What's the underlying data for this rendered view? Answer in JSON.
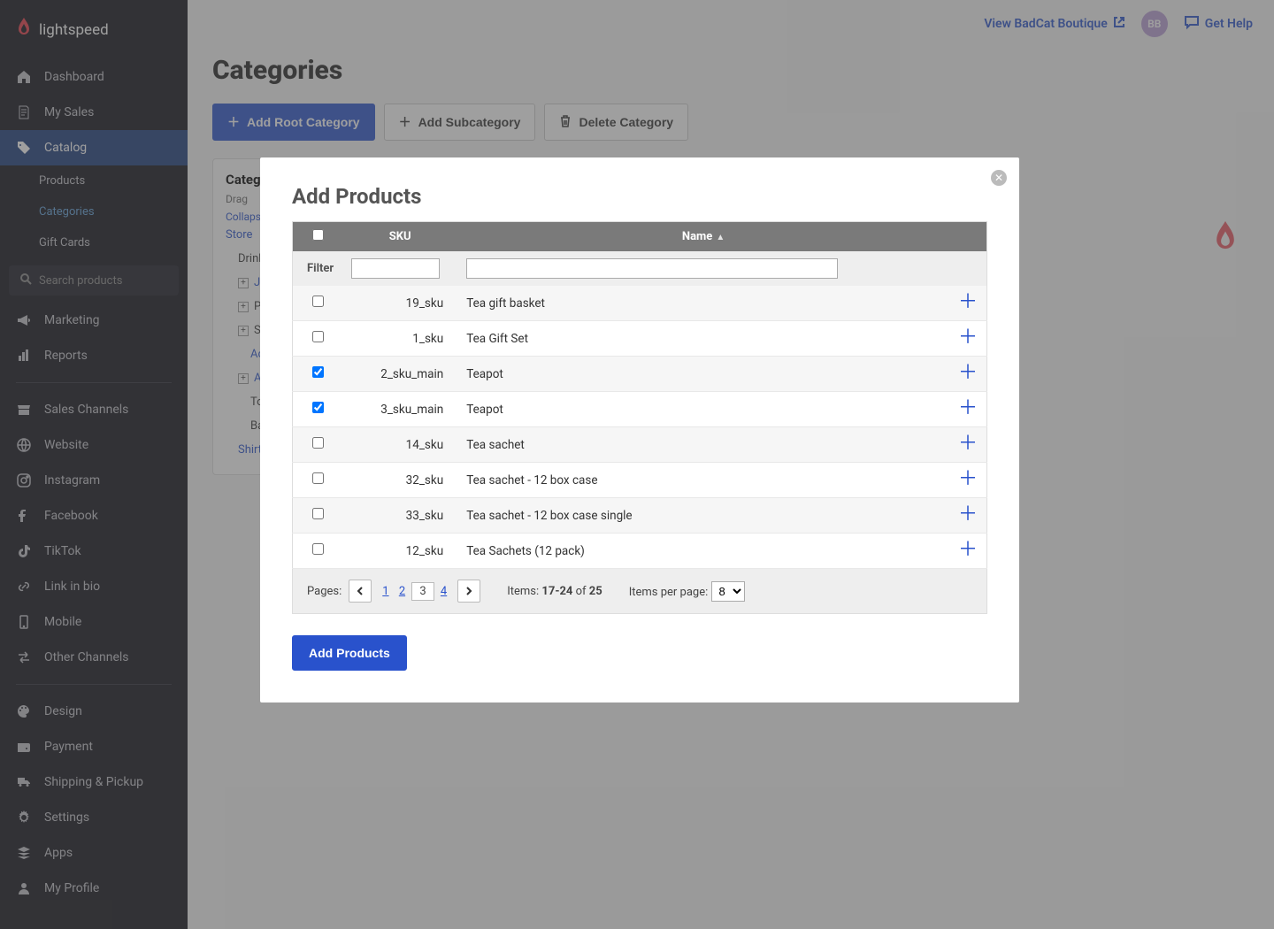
{
  "brand": "lightspeed",
  "header": {
    "view_store": "View BadCat Boutique",
    "avatar": "BB",
    "help": "Get Help"
  },
  "sidebar": {
    "items": [
      {
        "label": "Dashboard",
        "icon": "home"
      },
      {
        "label": "My Sales",
        "icon": "note"
      },
      {
        "label": "Catalog",
        "icon": "tag",
        "active": true
      },
      {
        "label": "Marketing",
        "icon": "megaphone"
      },
      {
        "label": "Reports",
        "icon": "bars"
      },
      {
        "label": "Sales Channels",
        "icon": "store"
      },
      {
        "label": "Website",
        "icon": "globe"
      },
      {
        "label": "Instagram",
        "icon": "instagram"
      },
      {
        "label": "Facebook",
        "icon": "facebook"
      },
      {
        "label": "TikTok",
        "icon": "tiktok"
      },
      {
        "label": "Link in bio",
        "icon": "link"
      },
      {
        "label": "Mobile",
        "icon": "mobile"
      },
      {
        "label": "Other Channels",
        "icon": "switch"
      },
      {
        "label": "Design",
        "icon": "palette"
      },
      {
        "label": "Payment",
        "icon": "wallet"
      },
      {
        "label": "Shipping & Pickup",
        "icon": "truck"
      },
      {
        "label": "Settings",
        "icon": "gear"
      },
      {
        "label": "Apps",
        "icon": "layers"
      },
      {
        "label": "My Profile",
        "icon": "user"
      }
    ],
    "catalog_sub": [
      {
        "label": "Products"
      },
      {
        "label": "Categories",
        "active": true
      },
      {
        "label": "Gift Cards"
      }
    ],
    "search_placeholder": "Search products"
  },
  "page": {
    "title": "Categories",
    "btn_add_root": "Add Root Category",
    "btn_add_sub": "Add Subcategory",
    "btn_delete": "Delete Category"
  },
  "cat_panel": {
    "title": "Categories",
    "help": "Drag",
    "collapse": "Collapse",
    "tree": [
      {
        "label": "Store",
        "link": true
      },
      {
        "label": "Drinkware",
        "link": false,
        "indent": 1
      },
      {
        "label": "Jackets",
        "link": true,
        "indent": 1,
        "plus": true
      },
      {
        "label": "Pants",
        "link": false,
        "indent": 1,
        "plus": true
      },
      {
        "label": "Shorts",
        "link": false,
        "indent": 1,
        "plus": true
      },
      {
        "label": "Accessories",
        "link": true,
        "indent": 2
      },
      {
        "label": "Apparel",
        "link": true,
        "indent": 1,
        "plus": true
      },
      {
        "label": "Tops",
        "link": false,
        "indent": 2
      },
      {
        "label": "Bags",
        "link": false,
        "indent": 2
      },
      {
        "label": "Shirts",
        "link": true,
        "indent": 1
      }
    ]
  },
  "modal": {
    "title": "Add Products",
    "col_sku": "SKU",
    "col_name": "Name",
    "filter_label": "Filter",
    "rows": [
      {
        "sku": "19_sku",
        "name": "Tea gift basket",
        "checked": false
      },
      {
        "sku": "1_sku",
        "name": "Tea Gift Set",
        "checked": false
      },
      {
        "sku": "2_sku_main",
        "name": "Teapot",
        "checked": true
      },
      {
        "sku": "3_sku_main",
        "name": "Teapot",
        "checked": true
      },
      {
        "sku": "14_sku",
        "name": "Tea sachet",
        "checked": false
      },
      {
        "sku": "32_sku",
        "name": "Tea sachet - 12 box case",
        "checked": false
      },
      {
        "sku": "33_sku",
        "name": "Tea sachet - 12 box case single",
        "checked": false
      },
      {
        "sku": "12_sku",
        "name": "Tea Sachets (12 pack)",
        "checked": false
      }
    ],
    "pager": {
      "label": "Pages:",
      "pages": [
        "1",
        "2",
        "3",
        "4"
      ],
      "current": "3",
      "items_label": "Items:",
      "items_range": "17-24",
      "of": "of",
      "items_total": "25",
      "ipp_label": "Items per page:",
      "ipp_value": "8"
    },
    "submit": "Add Products"
  }
}
